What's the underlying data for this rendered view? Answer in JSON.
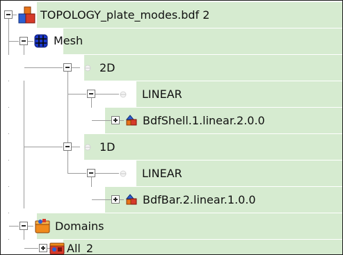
{
  "tree": {
    "root": {
      "label": "TOPOLOGY_plate_modes.bdf 2",
      "icon": "model-blocks-icon"
    },
    "mesh": {
      "label": "Mesh",
      "icon": "mesh-grid-icon"
    },
    "group_2d": {
      "label": "2D",
      "icon": "dimension-dot-icon"
    },
    "linear_2d": {
      "label": "LINEAR",
      "icon": "dimension-dot-icon"
    },
    "shell": {
      "label": "BdfShell.1.linear.2.0.0",
      "icon": "element-shapes-icon"
    },
    "group_1d": {
      "label": "1D",
      "icon": "dimension-dot-icon"
    },
    "linear_1d": {
      "label": "LINEAR",
      "icon": "dimension-dot-icon"
    },
    "bar": {
      "label": "BdfBar.2.linear.1.0.0",
      "icon": "element-shapes-icon"
    },
    "domains": {
      "label": "Domains",
      "icon": "domains-box-icon"
    },
    "all2": {
      "label": "All_2",
      "icon": "domain-all-icon"
    }
  },
  "colors": {
    "selected_row_bg": "#d6ebd0",
    "tree_line": "#9c9c9c",
    "border": "#1a1a1a"
  }
}
